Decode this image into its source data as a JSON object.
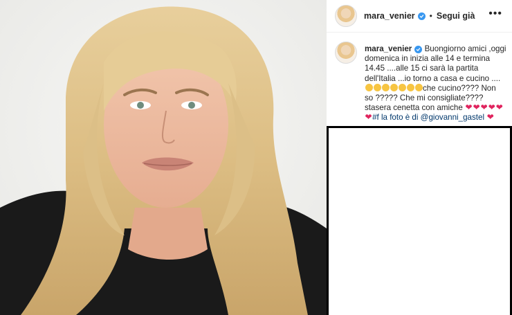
{
  "post": {
    "username": "mara_venier",
    "dot": "•",
    "follow_label": "Segui già",
    "more_label": "•••",
    "caption_user": "mara_venier",
    "caption_part1": "Buongiorno amici ,oggi domenica in inizia alle 14 e termina 14.45 ....alle 15 ci sarà la partita dell'Italia ...io torno a casa e cucino ....",
    "caption_part2": "che cucino???? Non so ????? Che mi consigliate???? stasera cenetta con amiche ",
    "caption_part3": "#f la foto è di ",
    "mention": "@giovanni_gastel",
    "heart_glyph": "❤"
  },
  "icons": {
    "verified": "verified-badge-icon",
    "more": "more-options-icon",
    "emoji": "grinning-face-icon",
    "heart": "red-heart-icon"
  },
  "colors": {
    "verified_blue": "#3897f0",
    "heart_red": "#e0245e",
    "link_blue": "#00376b",
    "text": "#262626"
  }
}
